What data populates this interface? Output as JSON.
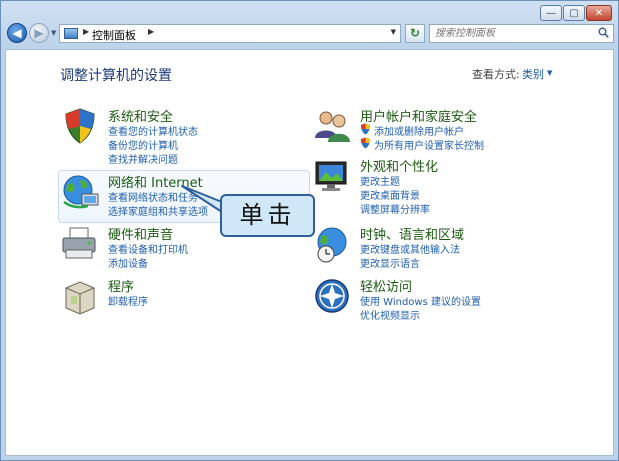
{
  "window": {
    "buttons": [
      "—",
      "▢",
      "✕"
    ]
  },
  "nav": {
    "back": "◀",
    "forward": "▶",
    "breadcrumb_root": "控制面板",
    "sep": "▶",
    "refresh": "↻",
    "search_placeholder": "搜索控制面板"
  },
  "header": {
    "title": "调整计算机的设置",
    "view_by_label": "查看方式:",
    "view_by_value": "类别"
  },
  "categories": [
    {
      "id": "system-security",
      "title": "系统和安全",
      "links": [
        "查看您的计算机状态",
        "备份您的计算机",
        "查找并解决问题"
      ]
    },
    {
      "id": "network",
      "title": "网络和 Internet",
      "links": [
        "查看网络状态和任务",
        "选择家庭组和共享选项"
      ]
    },
    {
      "id": "hardware-sound",
      "title": "硬件和声音",
      "links": [
        "查看设备和打印机",
        "添加设备"
      ]
    },
    {
      "id": "programs",
      "title": "程序",
      "links": [
        "卸载程序"
      ]
    },
    {
      "id": "user-accounts",
      "title": "用户帐户和家庭安全",
      "links": [
        "添加或删除用户帐户",
        "为所有用户设置家长控制"
      ]
    },
    {
      "id": "appearance",
      "title": "外观和个性化",
      "links": [
        "更改主题",
        "更改桌面背景",
        "调整屏幕分辨率"
      ]
    },
    {
      "id": "clock-region",
      "title": "时钟、语言和区域",
      "links": [
        "更改键盘或其他输入法",
        "更改显示语言"
      ]
    },
    {
      "id": "ease-access",
      "title": "轻松访问",
      "links": [
        "使用 Windows 建议的设置",
        "优化视频显示"
      ]
    }
  ],
  "callout": {
    "text": "单击"
  },
  "colors": {
    "heading": "#1b5b10",
    "link": "#1f5fb0",
    "title": "#1d3a7a"
  }
}
